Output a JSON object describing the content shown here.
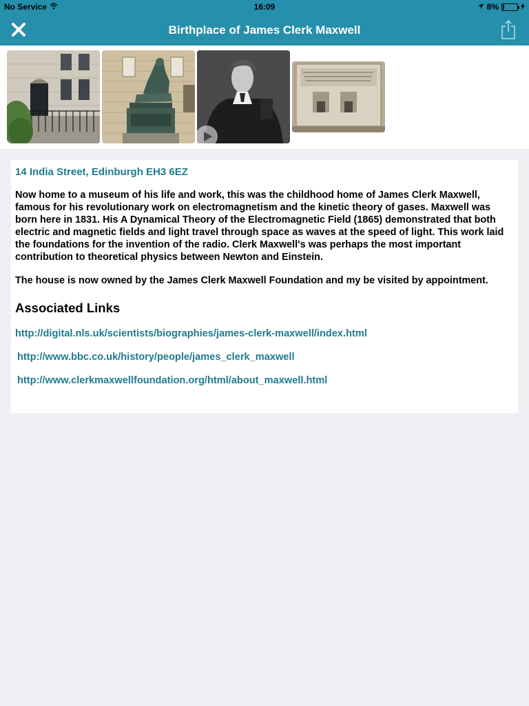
{
  "status": {
    "carrier": "No Service",
    "time": "16:09",
    "battery": "8%",
    "battery_level": 0.08
  },
  "nav": {
    "title": "Birthplace of James Clerk Maxwell",
    "close_icon": "close-icon",
    "share_icon": "share-icon"
  },
  "gallery": {
    "images": [
      {
        "name": "house-photo"
      },
      {
        "name": "statue-photo"
      },
      {
        "name": "portrait-photo",
        "has_play": true
      },
      {
        "name": "plaque-photo"
      }
    ]
  },
  "content": {
    "address": "14 India Street, Edinburgh EH3 6EZ",
    "paragraph1": "Now home to a museum of his life and work, this was the childhood home of James Clerk Maxwell, famous for his revolutionary work on electromagnetism and the kinetic theory of gases. Maxwell was born here in 1831. His A Dynamical Theory of the Electromagnetic Field (1865) demonstrated that both electric and magnetic fields and light travel through space as waves at the speed of light. This work laid the foundations for the invention of the radio. Clerk Maxwell's was perhaps the most important contribution to theoretical physics between Newton and Einstein.",
    "paragraph2": "The house is now owned by the James Clerk Maxwell Foundation and my be visited by appointment.",
    "links_heading": "Associated Links",
    "links": [
      "http://digital.nls.uk/scientists/biographies/james-clerk-maxwell/index.html",
      "http://www.bbc.co.uk/history/people/james_clerk_maxwell",
      "http://www.clerkmaxwellfoundation.org/html/about_maxwell.html"
    ]
  },
  "colors": {
    "accent": "#268fab",
    "link": "#1f7b8f",
    "background": "#efeff4"
  }
}
